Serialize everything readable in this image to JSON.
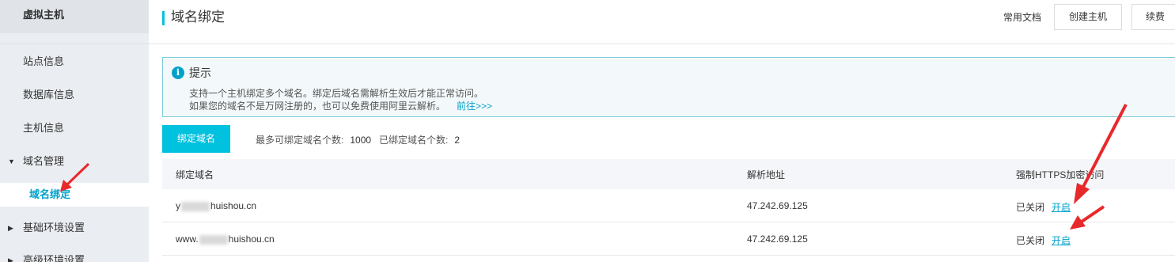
{
  "sidebar": {
    "title": "虚拟主机",
    "items": [
      {
        "label": "站点信息"
      },
      {
        "label": "数据库信息"
      },
      {
        "label": "主机信息"
      },
      {
        "label": "域名管理"
      },
      {
        "label": "域名绑定"
      },
      {
        "label": "基础环境设置"
      },
      {
        "label": "高级环境设置"
      }
    ]
  },
  "header": {
    "title": "域名绑定",
    "doc_link": "常用文档",
    "create_button": "创建主机",
    "renew_button": "续费"
  },
  "notice": {
    "title": "提示",
    "line1": "支持一个主机绑定多个域名。绑定后域名需解析生效后才能正常访问。",
    "line2": "如果您的域名不是万网注册的，也可以免费使用阿里云解析。",
    "link": "前往>>>"
  },
  "toolbar": {
    "bind_button": "绑定域名",
    "max_label": "最多可绑定域名个数:",
    "max_value": "1000",
    "bound_label": "已绑定域名个数:",
    "bound_value": "2"
  },
  "table": {
    "headers": [
      "绑定域名",
      "解析地址",
      "强制HTTPS加密访问"
    ],
    "rows": [
      {
        "domain_prefix": "y",
        "domain_suffix": "huishou.cn",
        "address": "47.242.69.125",
        "status": "已关闭",
        "action": "开启"
      },
      {
        "domain_prefix": "www.",
        "domain_suffix": "huishou.cn",
        "address": "47.242.69.125",
        "status": "已关闭",
        "action": "开启"
      }
    ]
  },
  "colors": {
    "accent": "#00c1de",
    "link": "#00a2ca",
    "annotation": "#e8292b"
  }
}
